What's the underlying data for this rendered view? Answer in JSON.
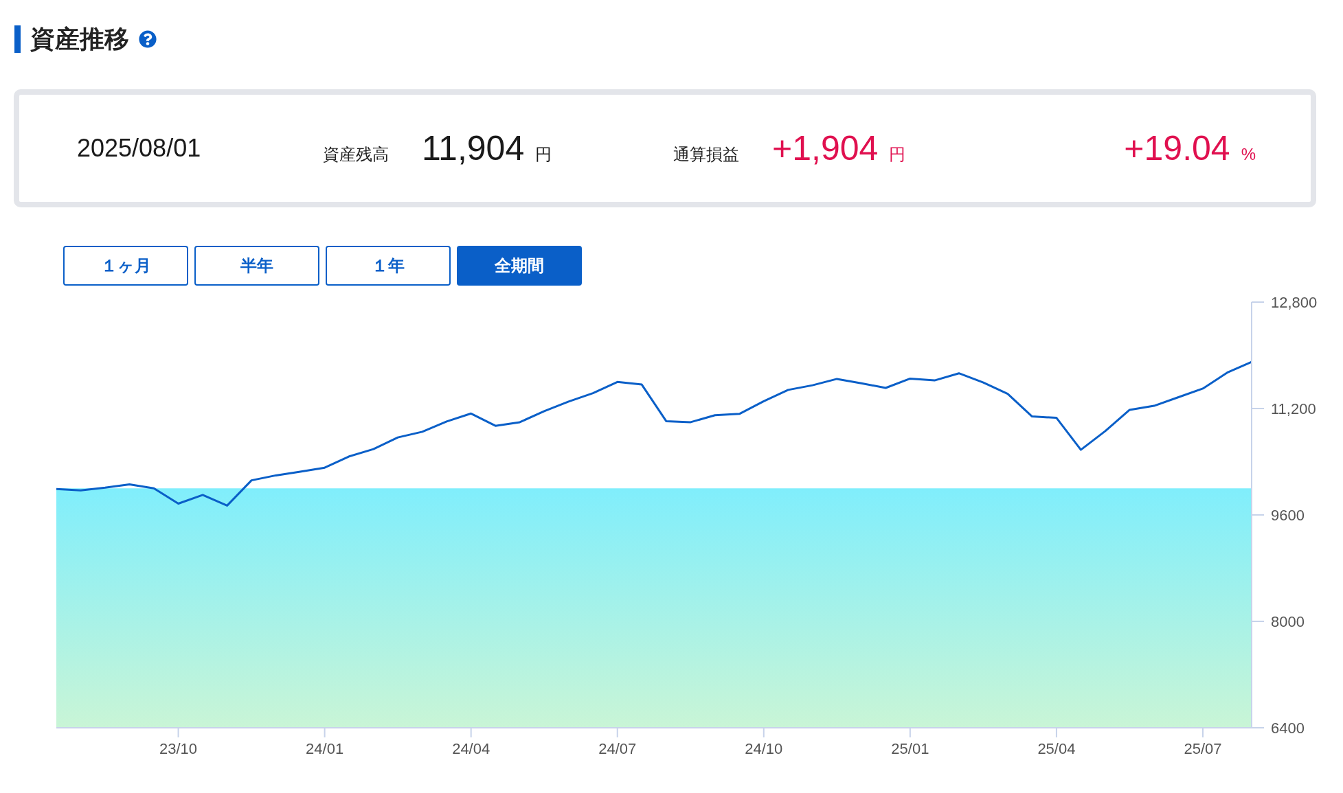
{
  "header": {
    "title": "資産推移"
  },
  "summary": {
    "date": "2025/08/01",
    "balance": {
      "label": "資産残高",
      "value": "11,904",
      "unit": "円"
    },
    "profit": {
      "label": "通算損益",
      "value": "+1,904",
      "unit": "円"
    },
    "return": {
      "value": "+19.04",
      "unit": "%"
    }
  },
  "tabs": [
    {
      "label": "１ヶ月",
      "selected": false
    },
    {
      "label": "半年",
      "selected": false
    },
    {
      "label": "１年",
      "selected": false
    },
    {
      "label": "全期間",
      "selected": true
    }
  ],
  "chart": {
    "chart_data": {
      "type": "line",
      "categories": [
        null,
        null,
        null,
        null,
        null,
        "23/10",
        null,
        null,
        null,
        null,
        null,
        "24/01",
        null,
        null,
        null,
        null,
        null,
        "24/04",
        null,
        null,
        null,
        null,
        null,
        "24/07",
        null,
        null,
        null,
        null,
        null,
        "24/10",
        null,
        null,
        null,
        null,
        null,
        "25/01",
        null,
        null,
        null,
        null,
        null,
        "25/04",
        null,
        null,
        null,
        null,
        null,
        "25/07",
        null,
        null
      ],
      "series": [
        {
          "type": "line",
          "color": "#0a5fc8",
          "values": [
            9990,
            9970,
            10010,
            10060,
            10000,
            9770,
            9900,
            9740,
            10120,
            10195,
            10250,
            10310,
            10480,
            10590,
            10765,
            10850,
            11005,
            11125,
            10940,
            10995,
            11160,
            11305,
            11430,
            11600,
            11560,
            11010,
            10995,
            11100,
            11120,
            11310,
            11480,
            11550,
            11645,
            11580,
            11510,
            11650,
            11622,
            11730,
            11590,
            11420,
            11080,
            11060,
            10580,
            10860,
            11180,
            11240,
            11370,
            11500,
            11740,
            11900
          ]
        },
        {
          "type": "area",
          "color": "#80eefc",
          "values": [
            10000,
            10000,
            10000,
            10000,
            10000,
            10000,
            10000,
            10000,
            10000,
            10000,
            10000,
            10000,
            10000,
            10000,
            10000,
            10000,
            10000,
            10000,
            10000,
            10000,
            10000,
            10000,
            10000,
            10000,
            10000,
            10000,
            10000,
            10000,
            10000,
            10000,
            10000,
            10000,
            10000,
            10000,
            10000,
            10000,
            10000,
            10000,
            10000,
            10000,
            10000,
            10000,
            10000,
            10000,
            10000,
            10000,
            10000,
            10000,
            10000,
            10000
          ]
        }
      ],
      "ylim": [
        6400,
        12800
      ],
      "yticks": [
        {
          "value": 12800,
          "label": "12,800"
        },
        {
          "value": 11200,
          "label": "11,200"
        },
        {
          "value": 9600,
          "label": "9600"
        },
        {
          "value": 8000,
          "label": "8000"
        },
        {
          "value": 6400,
          "label": "6400"
        }
      ]
    }
  }
}
